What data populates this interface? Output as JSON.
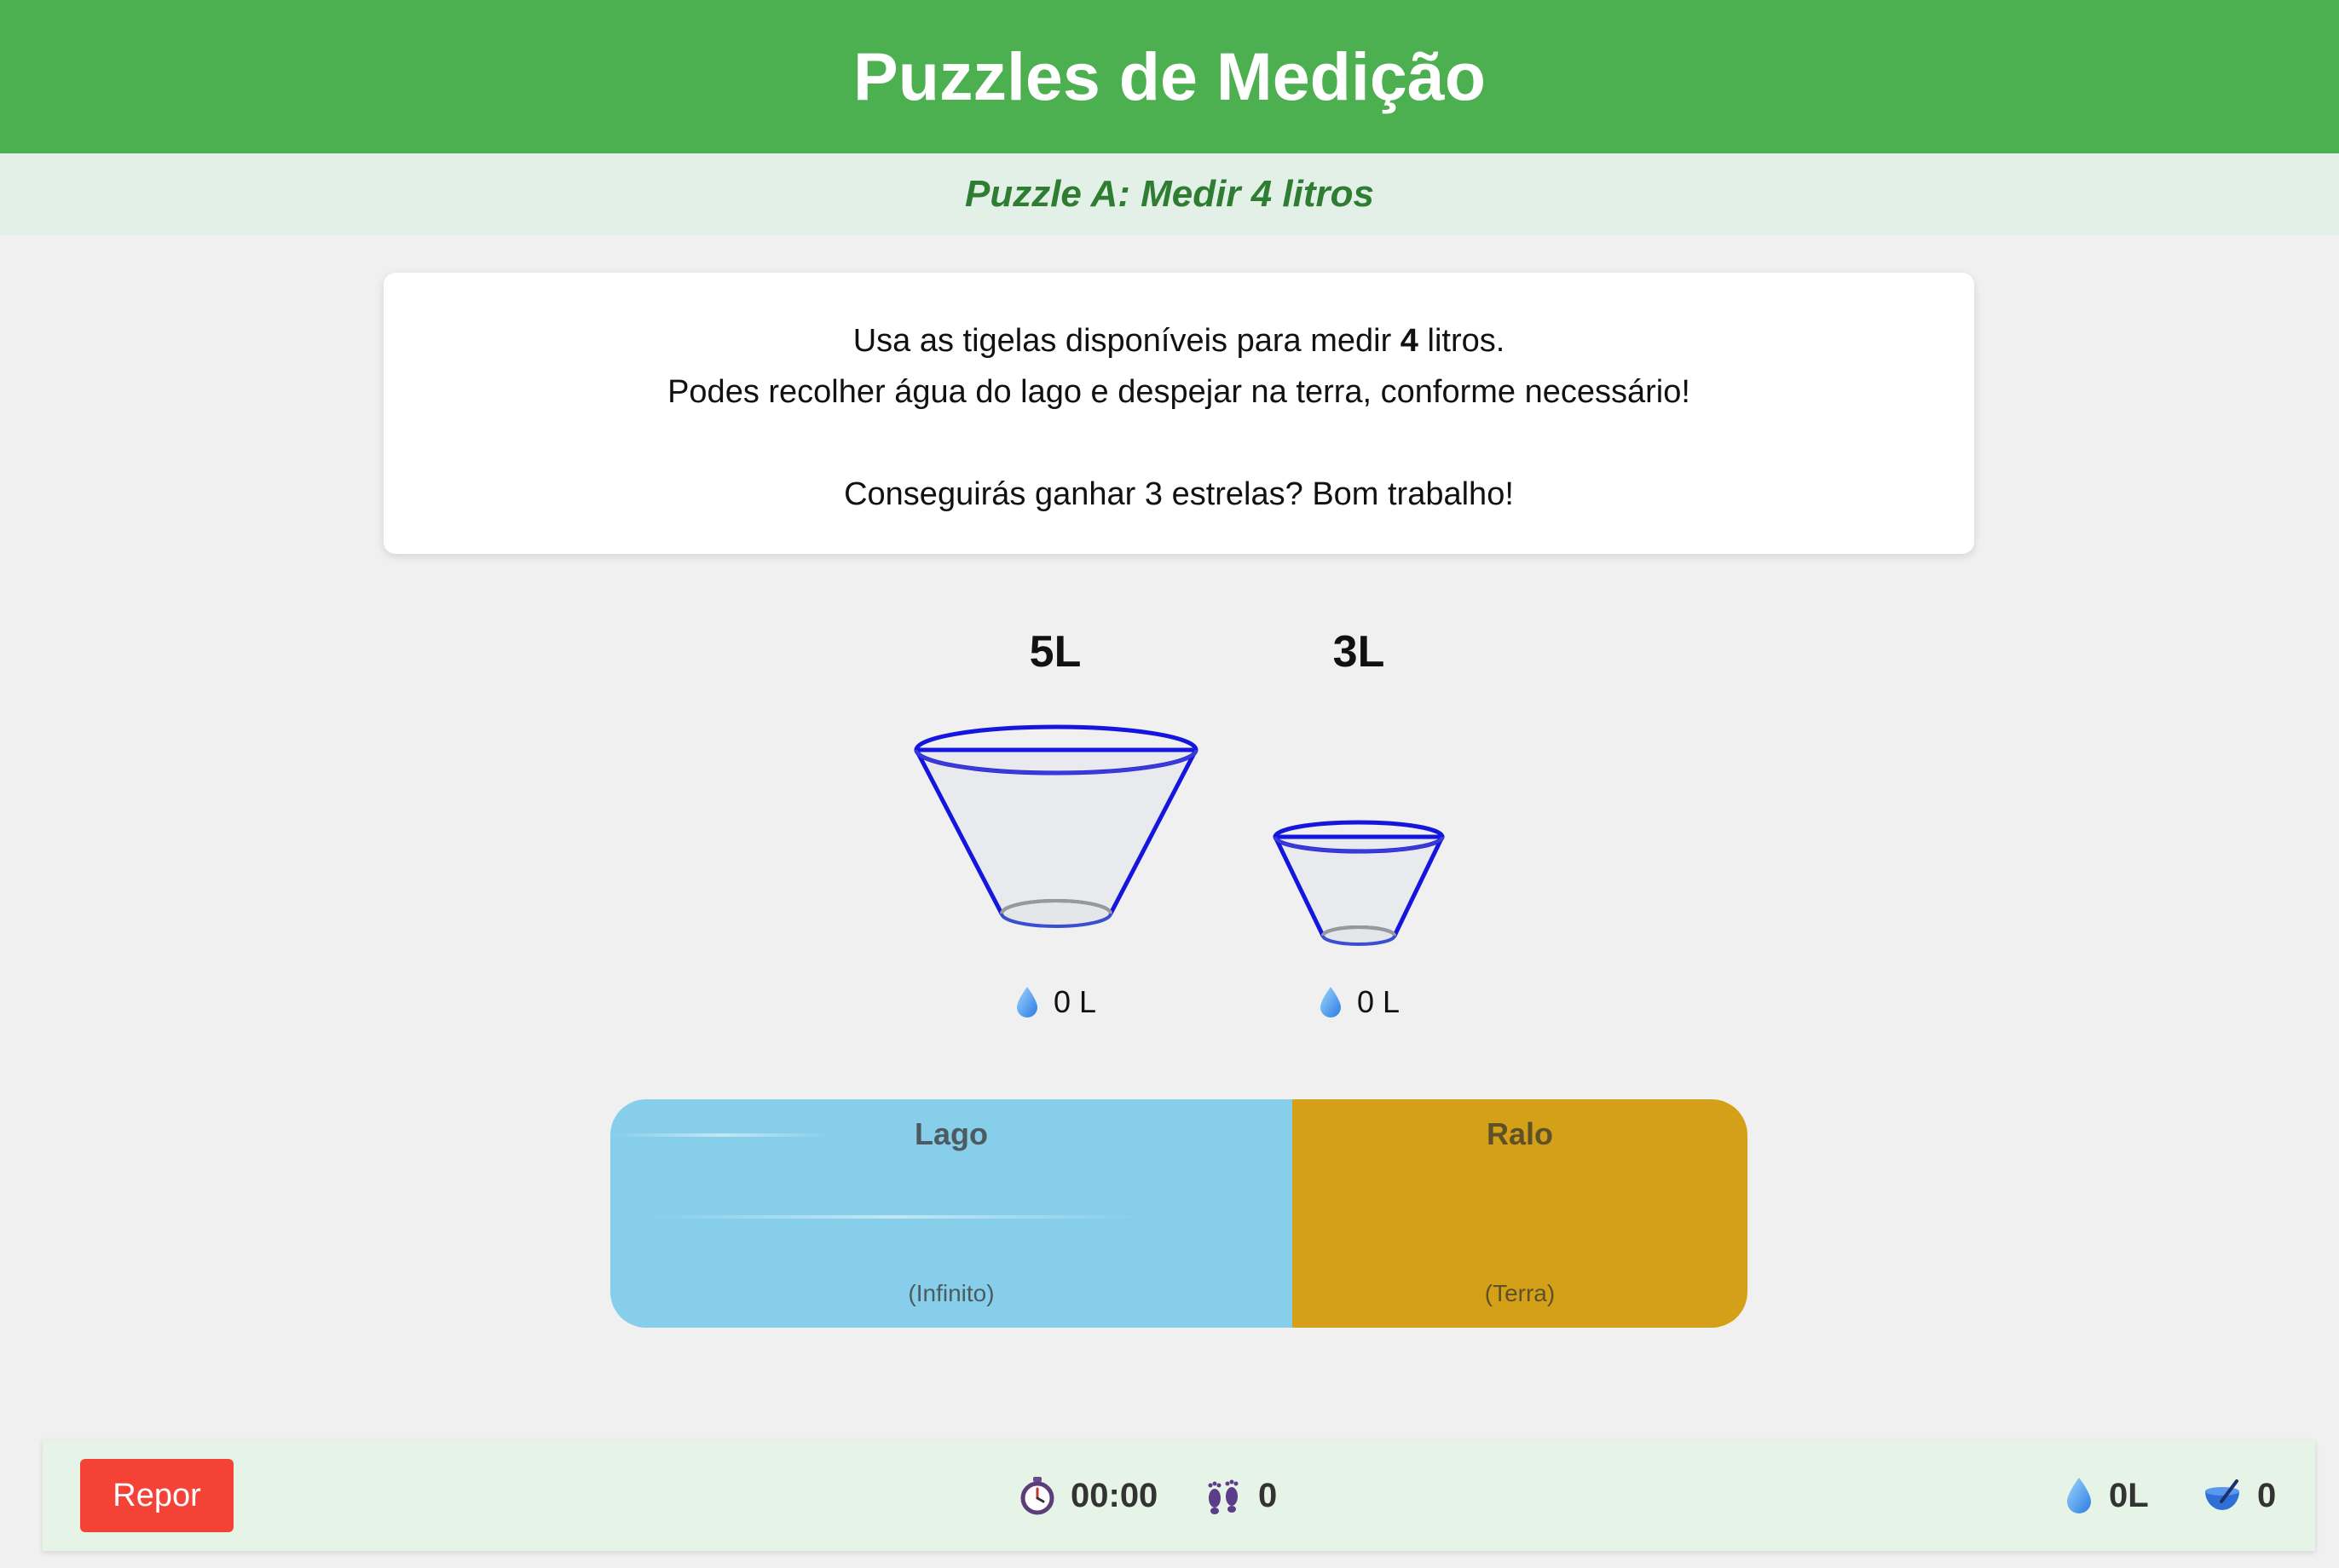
{
  "header": {
    "title": "Puzzles de Medição"
  },
  "puzzle": {
    "subtitle": "Puzzle A: Medir 4 litros"
  },
  "instructions": {
    "line1_before": "Usa as tigelas disponíveis para medir ",
    "line1_target": "4",
    "line1_after": " litros.",
    "line2": "Podes recolher água do lago e despejar na terra, conforme necessário!",
    "line3": "Conseguirás ganhar 3 estrelas? Bom trabalho!"
  },
  "bowls": [
    {
      "capacity_label": "5L",
      "amount_label": "0 L",
      "fill_fraction": 0
    },
    {
      "capacity_label": "3L",
      "amount_label": "0 L",
      "fill_fraction": 0
    }
  ],
  "zones": {
    "lake": {
      "name": "Lago",
      "note": "(Infinito)",
      "color": "#87ceeb"
    },
    "drain": {
      "name": "Ralo",
      "note": "(Terra)",
      "color": "#d4a017"
    }
  },
  "footer": {
    "reset_label": "Repor",
    "timer": "00:00",
    "steps": "0",
    "water": "0L",
    "pours": "0"
  },
  "icons": {
    "timer": "stopwatch-icon",
    "steps": "footprints-icon",
    "water": "water-drop-icon",
    "pours": "pour-bowl-icon"
  },
  "colors": {
    "header": "#4caf50",
    "subtitle": "#2e7d32",
    "bowl_outline": "#1515e0",
    "reset": "#f44336"
  }
}
